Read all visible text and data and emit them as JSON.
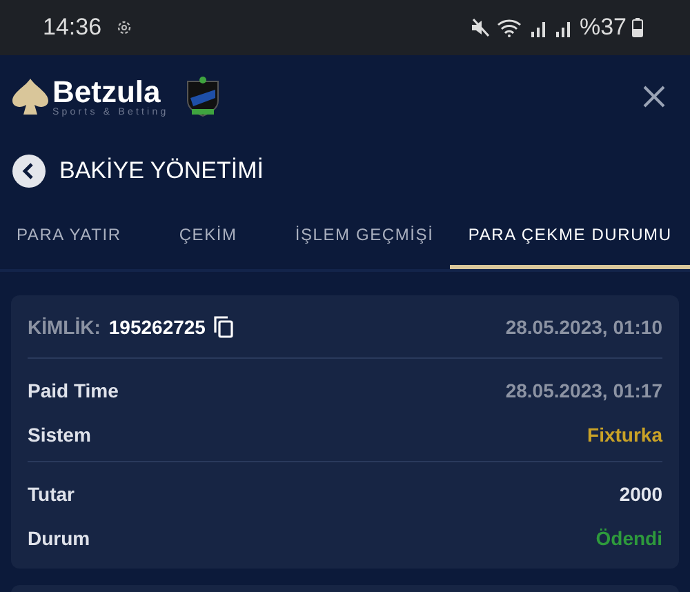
{
  "status_bar": {
    "time": "14:36",
    "battery": "%37"
  },
  "header": {
    "brand": "Betzula",
    "tagline": "Sports & Betting"
  },
  "page": {
    "title": "BAKİYE YÖNETİMİ"
  },
  "tabs": [
    {
      "label": "PARA YATIR",
      "selected": false
    },
    {
      "label": "ÇEKİM",
      "selected": false
    },
    {
      "label": "İŞLEM GEÇMİŞİ",
      "selected": false
    },
    {
      "label": "PARA ÇEKME DURUMU",
      "selected": true
    }
  ],
  "card": {
    "id_label": "KİMLİK:",
    "id_value": "195262725",
    "date": "28.05.2023, 01:10",
    "sections": [
      [
        {
          "label": "Paid Time",
          "value": "28.05.2023, 01:17",
          "color": "#8c93a3"
        },
        {
          "label": "Sistem",
          "value": "Fixturka",
          "color": "#c9a227"
        }
      ],
      [
        {
          "label": "Tutar",
          "value": "2000",
          "color": "#e4e7ee"
        },
        {
          "label": "Durum",
          "value": "Ödendi",
          "color": "#2e9a3c"
        }
      ]
    ]
  }
}
